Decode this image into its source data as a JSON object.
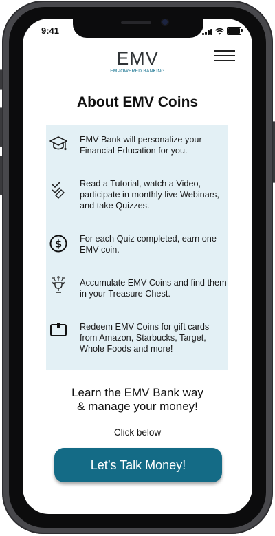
{
  "status_bar": {
    "time": "9:41"
  },
  "header": {
    "logo_text": "EMV",
    "logo_tagline": "EMPOWERED BANKING",
    "brand_color": "#0f6e8c"
  },
  "page": {
    "title": "About EMV Coins"
  },
  "steps": [
    {
      "icon": "graduation-cap-icon",
      "text": "EMV Bank will personalize your Financial Education for you."
    },
    {
      "icon": "checklist-icon",
      "text": "Read a Tutorial, watch a Video, participate in monthly live Webinars, and take Quizzes."
    },
    {
      "icon": "dollar-coin-icon",
      "text": "For each Quiz completed, earn one EMV coin."
    },
    {
      "icon": "trophy-icon",
      "text": "Accumulate EMV Coins and find them in your Treasure Chest."
    },
    {
      "icon": "gift-card-icon",
      "text": "Redeem EMV Coins for gift cards from Amazon, Starbucks, Target, Whole Foods and more!"
    }
  ],
  "tagline": {
    "line1": "Learn the EMV Bank way",
    "line2": "& manage your money!"
  },
  "cta": {
    "hint": "Click below",
    "label": "Let’s Talk Money!",
    "color": "#146b86"
  }
}
